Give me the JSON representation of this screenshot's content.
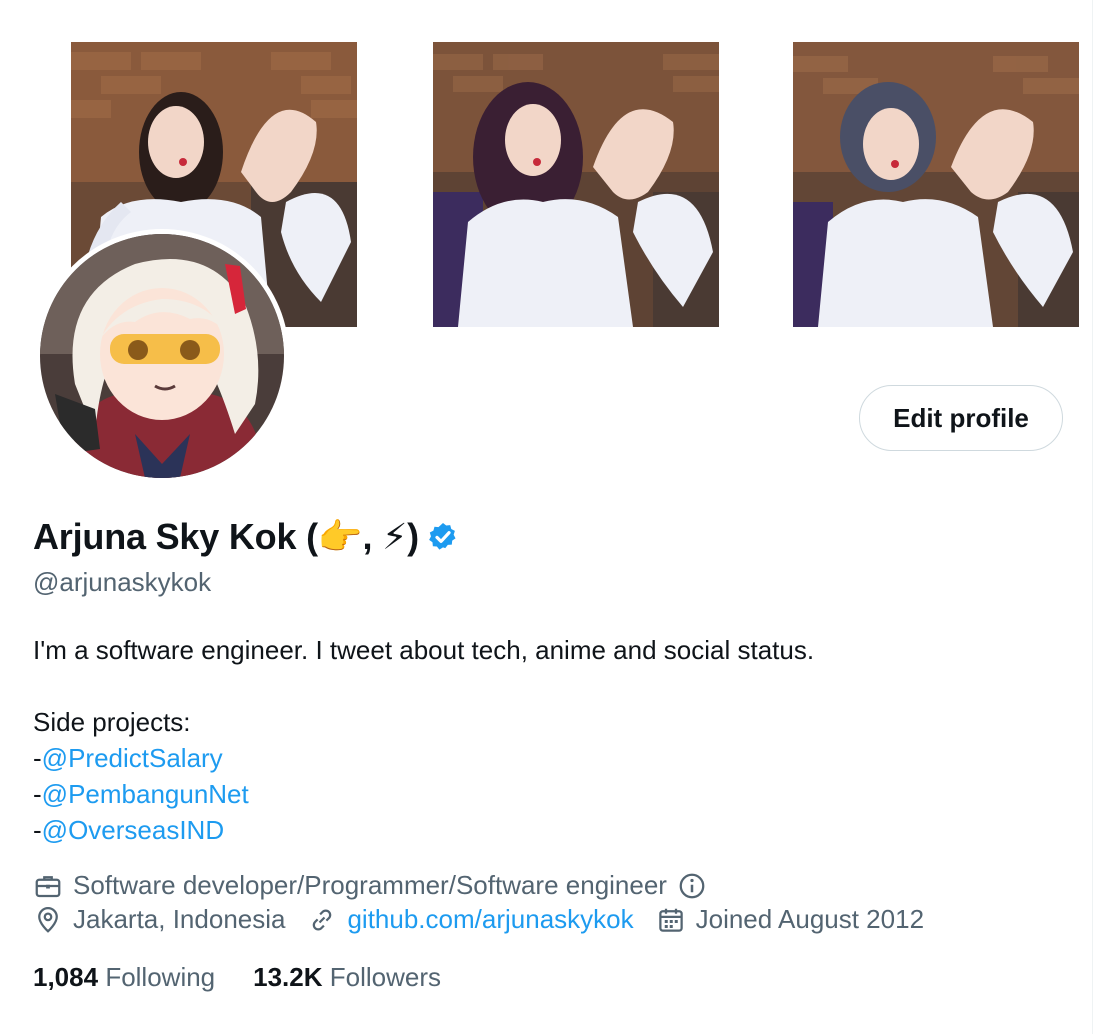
{
  "profile": {
    "display_name": "Arjuna Sky Kok (👉, ⚡)",
    "handle": "@arjunaskykok",
    "edit_button": "Edit profile",
    "bio_line_1": "I'm a software engineer. I tweet about tech, anime and social status.",
    "bio_side_projects_label": "Side projects:",
    "bio_dash": "-",
    "bio_mentions": [
      "@PredictSalary",
      "@PembangunNet",
      "@OverseasIND"
    ],
    "category": "Software developer/Programmer/Software engineer",
    "location": "Jakarta, Indonesia",
    "website": "github.com/arjunaskykok",
    "joined": "Joined August 2012",
    "following_count": "1,084",
    "following_label": "Following",
    "followers_count": "13.2K",
    "followers_label": "Followers"
  },
  "icons": {
    "verified": "verified-badge-icon",
    "briefcase": "briefcase-icon",
    "info": "info-icon",
    "location": "location-pin-icon",
    "link": "link-icon",
    "calendar": "calendar-icon"
  },
  "colors": {
    "accent": "#1d9bf0",
    "secondary_text": "#536471",
    "primary_text": "#0f1419"
  }
}
